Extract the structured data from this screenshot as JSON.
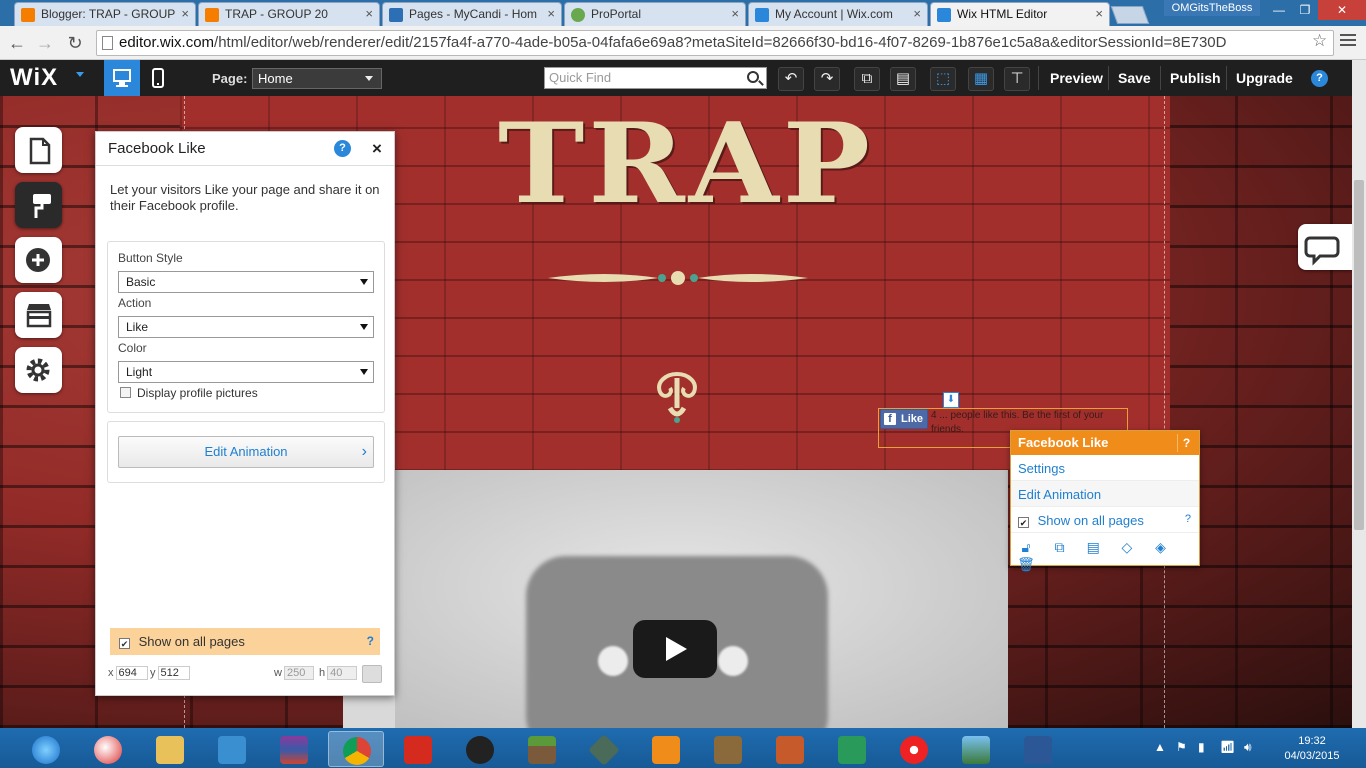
{
  "browser": {
    "tabs": [
      {
        "title": "Blogger: TRAP - GROUP",
        "favicon_color": "#f57d00"
      },
      {
        "title": "TRAP - GROUP 20",
        "favicon_color": "#f57d00"
      },
      {
        "title": "Pages - MyCandi - Hom",
        "favicon_color": "#2c6fb4"
      },
      {
        "title": "ProPortal",
        "favicon_color": "#6aa84f"
      },
      {
        "title": "My Account | Wix.com",
        "favicon_color": "#2a87d9"
      },
      {
        "title": "Wix HTML Editor",
        "favicon_color": "#2a87d9"
      }
    ],
    "user": "OMGitsTheBoss",
    "url_host": "editor.wix.com",
    "url_path": "/html/editor/web/renderer/edit/2157fa4f-a770-4ade-b05a-04fafa6e69a8?metaSiteId=82666f30-bd16-4f07-8269-1b876e1c5a8a&editorSessionId=8E730D"
  },
  "wix": {
    "logo": "WiX",
    "page_label": "Page:",
    "page_value": "Home",
    "quickfind_placeholder": "Quick Find",
    "actions": {
      "preview": "Preview",
      "save": "Save",
      "publish": "Publish",
      "upgrade": "Upgrade",
      "help": "?"
    }
  },
  "site": {
    "title": "TRAP",
    "fb_button": "Like",
    "fb_text": "4 ... people like this. Be the first of your friends."
  },
  "panel": {
    "title": "Facebook Like",
    "help": "?",
    "close": "×",
    "description": "Let your visitors Like your page and share it on their Facebook profile.",
    "button_style_label": "Button Style",
    "button_style_value": "Basic",
    "action_label": "Action",
    "action_value": "Like",
    "color_label": "Color",
    "color_value": "Light",
    "profile_pictures_label": "Display profile pictures",
    "edit_animation": "Edit Animation",
    "show_all_pages": "Show on all pages",
    "show_all_help": "?",
    "x_label": "x",
    "x_value": "694",
    "y_label": "y",
    "y_value": "512",
    "w_label": "w",
    "w_value": "250",
    "h_label": "h",
    "h_value": "40"
  },
  "context_menu": {
    "title": "Facebook Like",
    "help": "?",
    "settings": "Settings",
    "edit_animation": "Edit Animation",
    "show_all_pages": "Show on all pages",
    "show_all_help": "?"
  },
  "taskbar": {
    "time": "19:32",
    "date": "04/03/2015"
  }
}
